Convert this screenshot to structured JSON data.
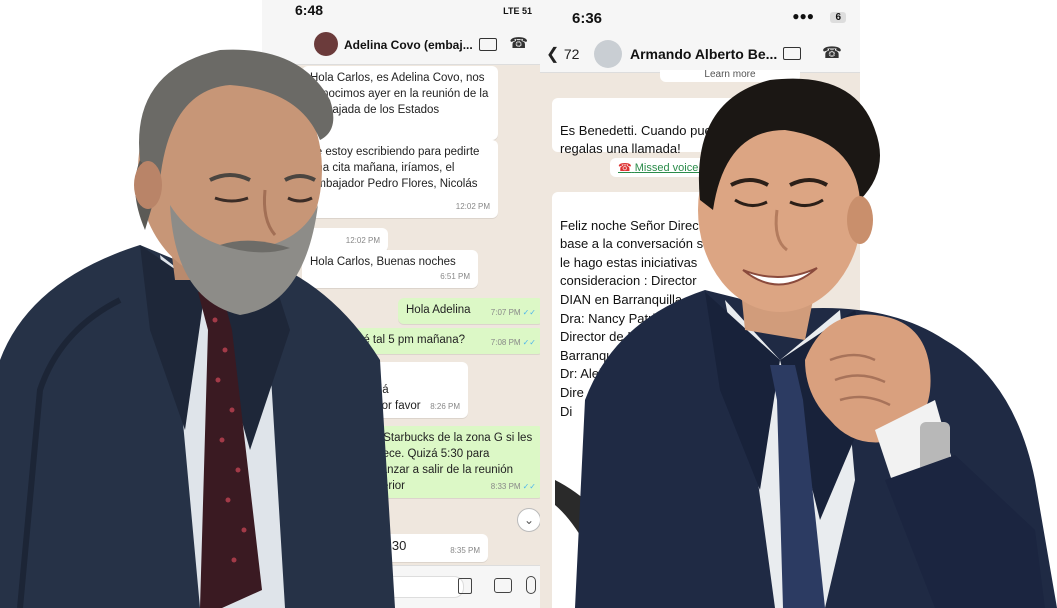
{
  "phone_left": {
    "time": "6:48",
    "network": "LTE",
    "battery": "51",
    "contact_name": "Adelina Covo (embaj...",
    "messages": [
      {
        "dir": "in",
        "text": "Hola Carlos, es Adelina Covo, nos conocimos ayer en la reunión de la embajada de los Estados",
        "time": ""
      },
      {
        "dir": "in",
        "text": "Te estoy escribiendo para pedirte una cita mañana, iríamos, el embajador Pedro Flores, Nicolás",
        "time": "12:02 PM"
      },
      {
        "dir": "in",
        "text": "",
        "time": "12:02 PM"
      },
      {
        "dir": "in",
        "text": "Hola Carlos, Buenas noches",
        "time": "6:51 PM"
      },
      {
        "dir": "out",
        "text": "Hola Adelina",
        "time": "7:07 PM"
      },
      {
        "dir": "out",
        "text": "Qué tal 5 pm mañana?",
        "time": "7:08 PM"
      },
      {
        "dir": "in",
        "text": "Don Carlos allá\nDime dónde por favor",
        "time": "8:26 PM"
      },
      {
        "dir": "out",
        "text": "En Starbucks de la zona G si les parece. Quizá 5:30 para alcanzar a salir de la reunión anterior",
        "time": "8:33 PM"
      },
      {
        "dir": "in",
        "text": "Listo 5:30",
        "time": "8:35 PM"
      }
    ]
  },
  "phone_right": {
    "time": "6:36",
    "battery": "6",
    "back_count": "72",
    "contact_name": "Armando Alberto Be...",
    "learn_more": "Learn more",
    "messages": [
      {
        "text": "Es Benedetti. Cuando pueda\nregalas una llamada!"
      },
      {
        "text": "Missed voice c"
      },
      {
        "text": "Feliz noche Señor Direc\nbase a la conversación s\nle hago estas iniciativas\nconsideracion : Director\nDIAN en Barranquilla.\nDra: Nancy Patricia Hol\nDirector de Impuestos\nBarranquilla\nDr: Aleja\nDire\nDi"
      }
    ]
  },
  "colors": {
    "chat_bg": "#efe7de",
    "outgoing_bubble": "#dcf8c6",
    "incoming_bubble": "#ffffff",
    "suit_dark": "#263247"
  }
}
